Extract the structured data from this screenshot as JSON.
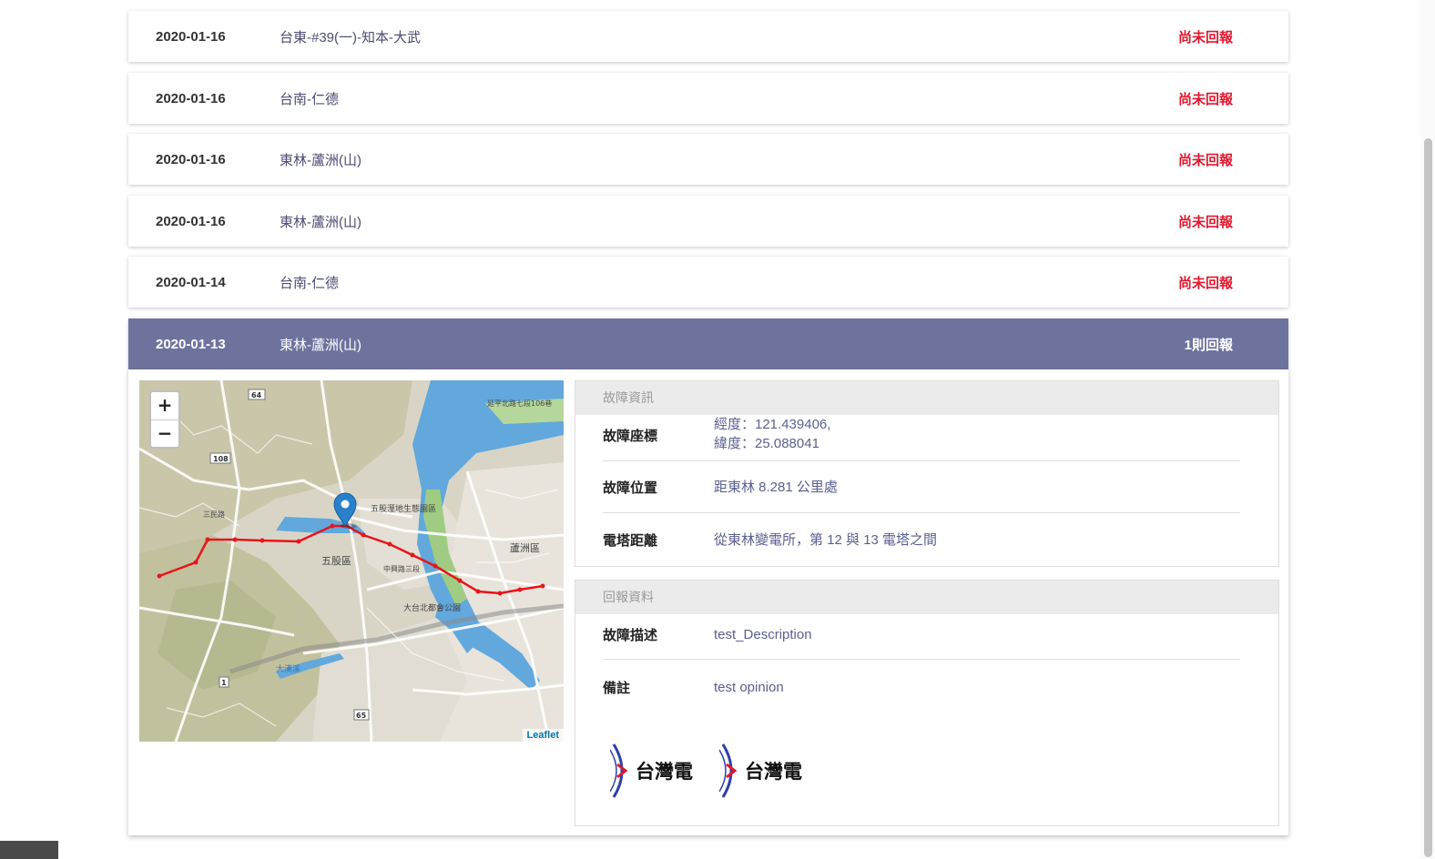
{
  "rows": [
    {
      "date": "2020-01-16",
      "location": "台東-#39(一)-知本-大武",
      "status": "尚未回報"
    },
    {
      "date": "2020-01-16",
      "location": "台南-仁德",
      "status": "尚未回報"
    },
    {
      "date": "2020-01-16",
      "location": "東林-蘆洲(山)",
      "status": "尚未回報"
    },
    {
      "date": "2020-01-16",
      "location": "東林-蘆洲(山)",
      "status": "尚未回報"
    },
    {
      "date": "2020-01-14",
      "location": "台南-仁德",
      "status": "尚未回報"
    },
    {
      "date": "2020-01-13",
      "location": "東林-蘆洲(山)",
      "status": "1則回報"
    }
  ],
  "map": {
    "zoom_in": "+",
    "zoom_out": "−",
    "attribution": "Leaflet",
    "labels": {
      "wugu": "五股區",
      "luzhou": "蘆洲區",
      "park": "五股溼地生態園區",
      "metro": "大台北都會公園",
      "r64": "64",
      "r108": "108",
      "r65": "65",
      "r1": "1",
      "yanping": "延平北路七段106巷",
      "river": "大漢溪",
      "zhongxing": "中興路三段",
      "sanmin": "三民路"
    }
  },
  "fault_info": {
    "title": "故障資訊",
    "coord_label": "故障座標",
    "longitude": "經度：121.439406,",
    "latitude": "緯度：25.088041",
    "position_label": "故障位置",
    "position_value": "距東林 8.281 公里處",
    "tower_label": "電塔距離",
    "tower_value": "從東林變電所，第 12 與 13 電塔之間"
  },
  "report_info": {
    "title": "回報資料",
    "desc_label": "故障描述",
    "desc_value": "test_Description",
    "note_label": "備註",
    "note_value": "test opinion",
    "logo_text": "台灣電"
  },
  "colors": {
    "active_row": "#6e739e",
    "pending_status": "#e0182d",
    "route": "#e8141c",
    "marker": "#2a81cb"
  }
}
